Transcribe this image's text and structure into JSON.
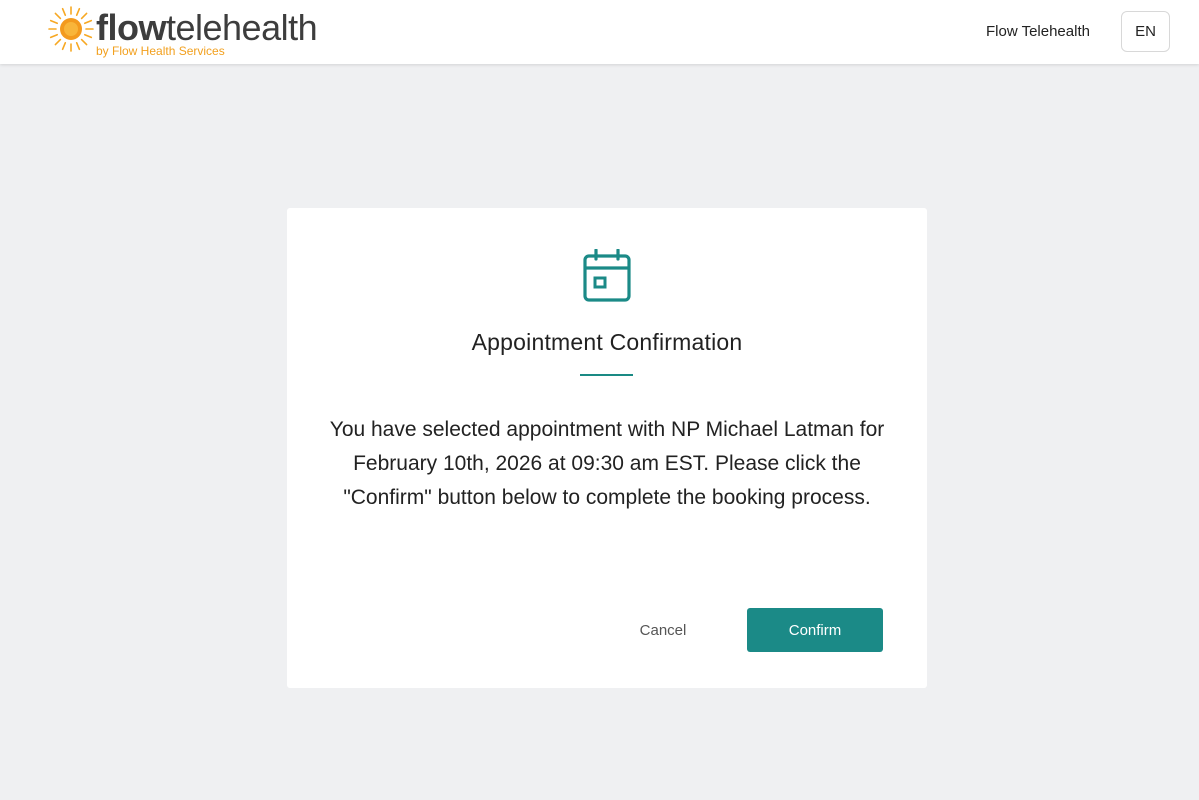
{
  "header": {
    "logo": {
      "word_bold": "flow",
      "word_regular": "telehealth",
      "tagline": "by Flow Health Services"
    },
    "nav_brand": "Flow Telehealth",
    "language": "EN"
  },
  "dialog": {
    "icon": "calendar-icon",
    "title": "Appointment Confirmation",
    "message": "You have selected appointment with NP Michael Latman for February 10th, 2026 at 09:30 am EST. Please click the \"Confirm\" button below to complete the booking process.",
    "cancel_label": "Cancel",
    "confirm_label": "Confirm"
  },
  "colors": {
    "accent": "#1b8a87",
    "logo_orange": "#f2a01e",
    "background": "#eff0f2"
  }
}
